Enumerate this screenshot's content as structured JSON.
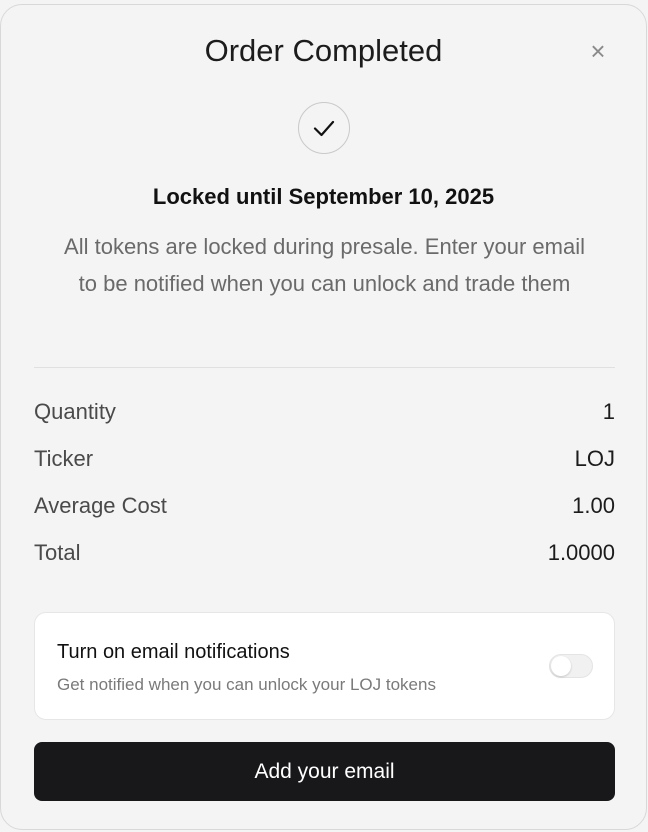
{
  "header": {
    "title": "Order Completed",
    "close_icon": "close-icon"
  },
  "status": {
    "icon": "check-icon",
    "locked_title": "Locked until September 10, 2025",
    "description": "All tokens are locked during presale. Enter your email to be notified when you can unlock and trade them"
  },
  "details": [
    {
      "label": "Quantity",
      "value": "1"
    },
    {
      "label": "Ticker",
      "value": "LOJ"
    },
    {
      "label": "Average Cost",
      "value": "1.00"
    },
    {
      "label": "Total",
      "value": "1.0000"
    }
  ],
  "notifications": {
    "title": "Turn on email notifications",
    "subtitle": "Get notified when you can unlock your LOJ tokens",
    "enabled": false
  },
  "cta": {
    "label": "Add your email"
  },
  "colors": {
    "background": "#f4f4f4",
    "button": "#18181b",
    "card": "#ffffff"
  }
}
